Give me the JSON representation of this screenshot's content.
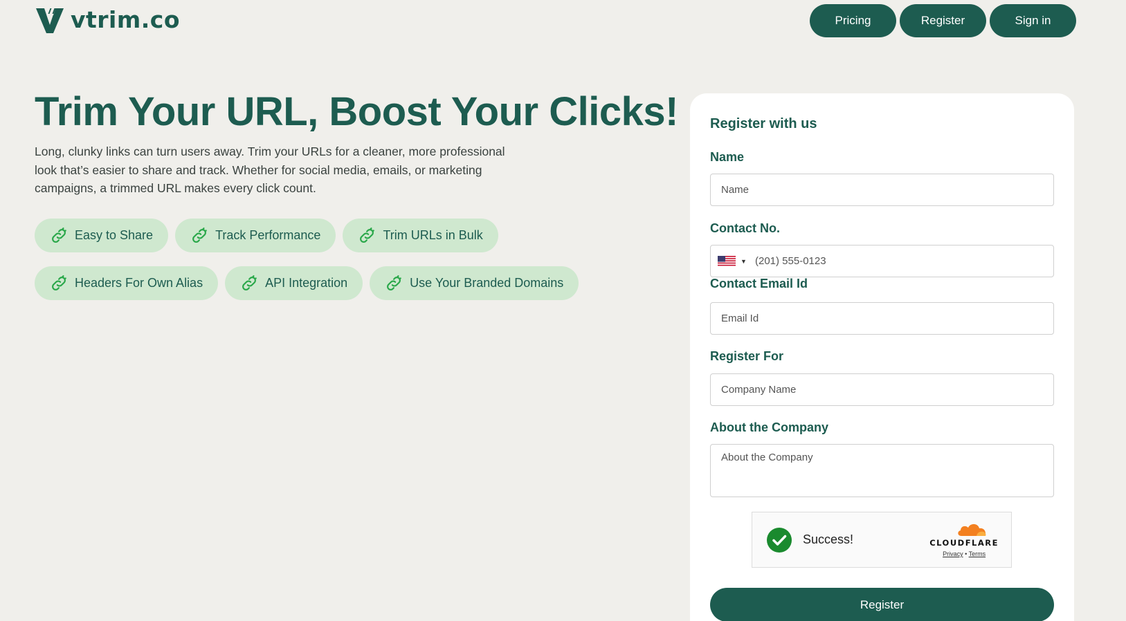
{
  "brand": {
    "name": "vtrim.co"
  },
  "nav": {
    "pricing": "Pricing",
    "register": "Register",
    "signin": "Sign in"
  },
  "hero": {
    "title": "Trim Your URL, Boost Your Clicks!",
    "description": "Long, clunky links can turn users away. Trim your URLs for a cleaner, more professional look that’s easier to share and track. Whether for social media, emails, or marketing campaigns, a trimmed URL makes every click count."
  },
  "features": [
    {
      "label": "Easy to Share",
      "icon": "link-icon"
    },
    {
      "label": "Track Performance",
      "icon": "link-icon"
    },
    {
      "label": "Trim URLs in Bulk",
      "icon": "link-icon"
    },
    {
      "label": "Headers For Own Alias",
      "icon": "link-icon"
    },
    {
      "label": "API Integration",
      "icon": "link-icon"
    },
    {
      "label": "Use Your Branded Domains",
      "icon": "link-icon"
    }
  ],
  "form": {
    "title": "Register with us",
    "name_label": "Name",
    "name_placeholder": "Name",
    "contact_label": "Contact No.",
    "contact_placeholder": "(201) 555-0123",
    "email_label": "Contact Email Id",
    "email_placeholder": "Email Id",
    "register_for_label": "Register For",
    "register_for_placeholder": "Company Name",
    "about_label": "About the Company",
    "about_placeholder": "About the Company",
    "captcha": {
      "status": "Success!",
      "brand": "CLOUDFLARE",
      "privacy": "Privacy",
      "separator": "•",
      "terms": "Terms"
    },
    "submit_label": "Register"
  },
  "colors": {
    "primary": "#1d5c50",
    "pill_bg": "#cfe8cf",
    "page_bg": "#f0efeb",
    "success": "#1a8a2e",
    "cloudflare": "#f38020"
  }
}
